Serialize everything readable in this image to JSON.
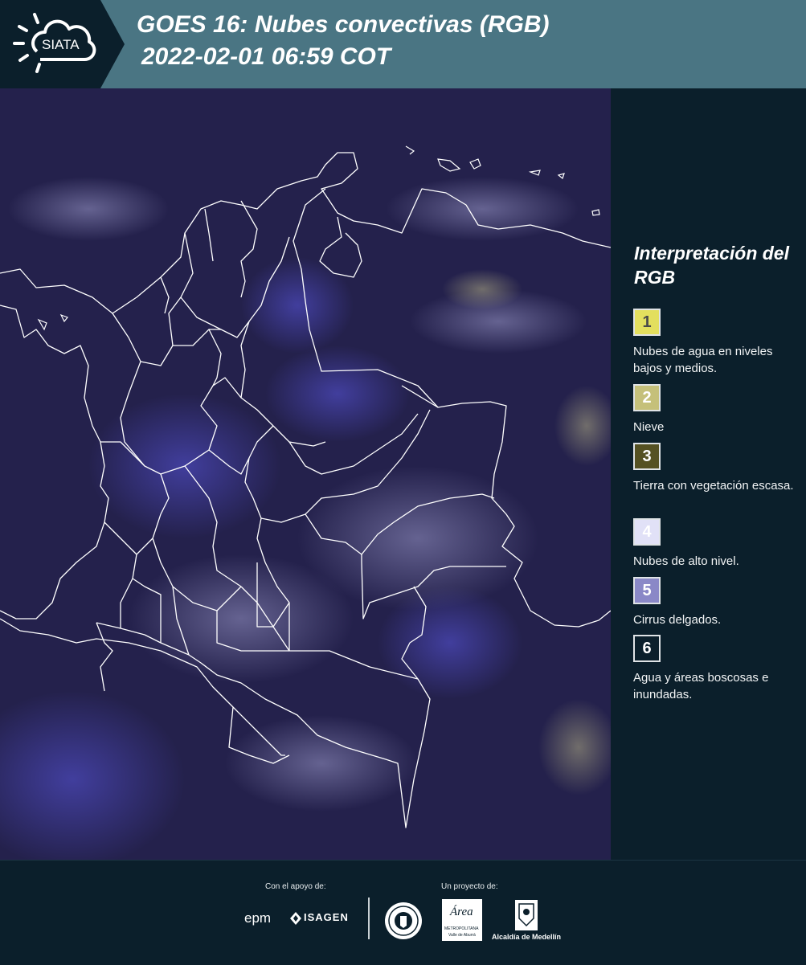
{
  "header": {
    "logo_text": "SIATA",
    "title_line1": "GOES 16: Nubes convectivas (RGB)",
    "title_line2": "2022-02-01 06:59 COT"
  },
  "map": {
    "background_color": "#24204e",
    "border_color": "#ffffff"
  },
  "legend": {
    "title": "Interpretación del RGB",
    "items": [
      {
        "number": "1",
        "label": "Nubes de agua en niveles bajos y medios.",
        "color": "#e3df5e",
        "number_color": "#4a4a4a"
      },
      {
        "number": "2",
        "label": "Nieve",
        "color": "#c5c07a",
        "number_color": "#ffffff"
      },
      {
        "number": "3",
        "label": "Tierra con vegetación escasa.",
        "color": "#555122",
        "number_color": "#ffffff"
      },
      {
        "number": "4",
        "label": "Nubes de alto nivel.",
        "color": "#e1e1f7",
        "number_color": "#ffffff"
      },
      {
        "number": "5",
        "label": "Cirrus delgados.",
        "color": "#8a88c7",
        "number_color": "#ffffff"
      },
      {
        "number": "6",
        "label": "Agua y áreas boscosas e inundadas.",
        "color": "#0b1f2b",
        "number_color": "#ffffff"
      }
    ]
  },
  "footer": {
    "support_caption": "Con el apoyo de:",
    "project_caption": "Un proyecto de:",
    "support_logos": [
      "epm",
      "ISAGEN"
    ],
    "project_logos": [
      "Área Metropolitana Valle de Aburrá",
      "Alcaldía de Medellín"
    ],
    "epm_text": "epm",
    "isagen_text": "ISAGEN",
    "area_text": "Área",
    "area_subtext": "METROPOLITANA",
    "area_subtext2": "Valle de Aburrá",
    "alcaldia_text": "Alcaldía de Medellín"
  }
}
